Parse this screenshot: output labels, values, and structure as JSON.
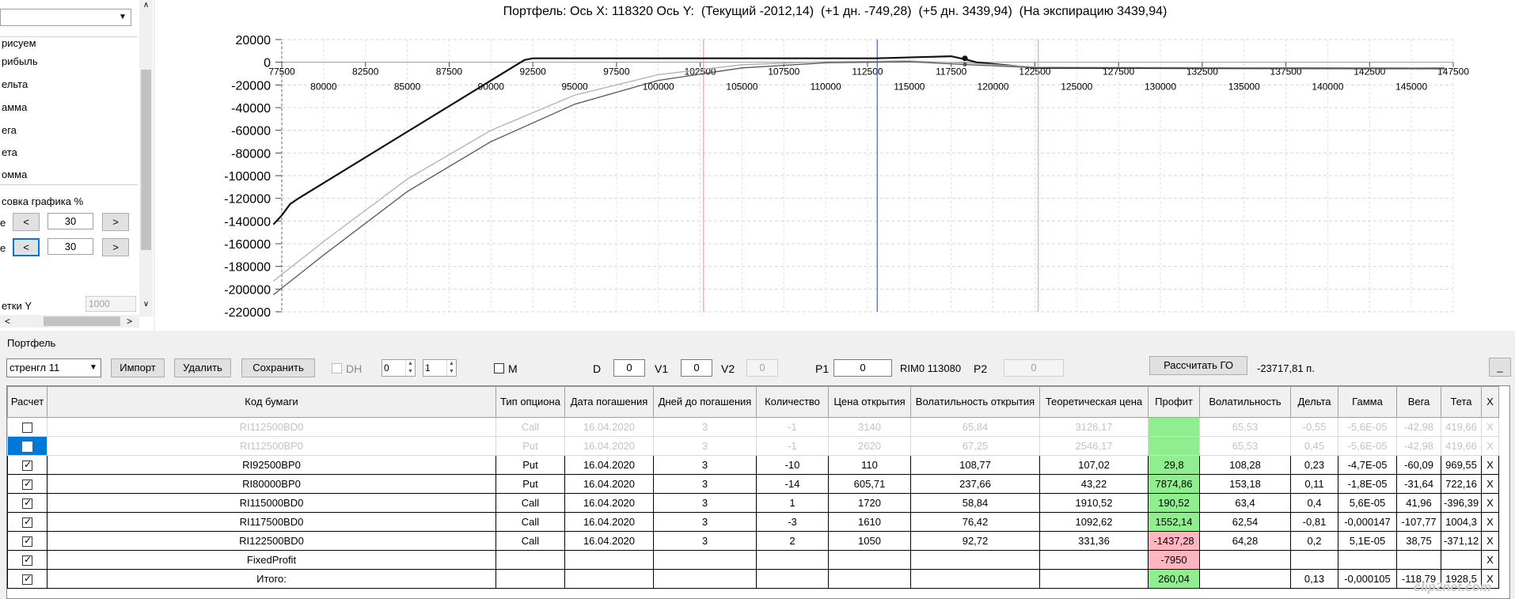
{
  "left_panel": {
    "series": [
      "рисуем",
      "рибыль",
      "ельта",
      "амма",
      "ега",
      "ета",
      "омма"
    ],
    "scale_title": "совка графика %",
    "row1_label": "е",
    "row2_label": "е",
    "row1_value": "30",
    "row2_value": "30",
    "prev_label": "<",
    "next_label": ">",
    "y_spacing_label": "етки Y",
    "y_spacing_value": "1000",
    "scroll_up": "∧",
    "scroll_down": "∨",
    "scroll_left": "<",
    "scroll_right": ">"
  },
  "chart": {
    "title": "Портфель: Ось X: 118320 Ось Y:  (Текущий -2012,14)  (+1 дн. -749,28)  (+5 дн. 3439,94)  (На экспирацию 3439,94)"
  },
  "chart_data": {
    "type": "line",
    "xlim": [
      77500,
      147500
    ],
    "ylim": [
      -220000,
      20000
    ],
    "x_ticks_upper": [
      77500,
      82500,
      87500,
      92500,
      97500,
      102500,
      107500,
      112500,
      117500,
      122500,
      127500,
      132500,
      137500,
      142500,
      147500
    ],
    "x_ticks_lower": [
      80000,
      85000,
      90000,
      95000,
      100000,
      105000,
      110000,
      115000,
      120000,
      125000,
      130000,
      135000,
      140000,
      145000
    ],
    "y_ticks": [
      20000,
      0,
      -20000,
      -40000,
      -60000,
      -80000,
      -100000,
      -120000,
      -140000,
      -160000,
      -180000,
      -200000,
      -220000
    ],
    "vertical_lines": [
      {
        "x": 102700,
        "color": "#f4a0a0"
      },
      {
        "x": 113080,
        "color": "#3c64c8"
      },
      {
        "x": 122700,
        "color": "#f4a0a0"
      }
    ],
    "cursor_point": {
      "x": 118320,
      "y": 3440
    },
    "series": [
      {
        "color": "#111111",
        "points": [
          [
            77000,
            -143000
          ],
          [
            77500,
            -135000
          ],
          [
            78000,
            -125000
          ],
          [
            78500,
            -120000
          ],
          [
            92000,
            2000
          ],
          [
            92500,
            3440
          ],
          [
            113000,
            3440
          ],
          [
            117500,
            5300
          ],
          [
            118500,
            2000
          ],
          [
            119000,
            0
          ],
          [
            122500,
            -5000
          ],
          [
            147000,
            -5500
          ]
        ]
      },
      {
        "color": "#b0b0b0",
        "points": [
          [
            77000,
            -193000
          ],
          [
            80000,
            -158000
          ],
          [
            85000,
            -103000
          ],
          [
            90000,
            -60000
          ],
          [
            95000,
            -29000
          ],
          [
            100000,
            -11000
          ],
          [
            105000,
            -2200
          ],
          [
            110000,
            500
          ],
          [
            115000,
            1200
          ],
          [
            118320,
            -749
          ],
          [
            122500,
            -4200
          ],
          [
            147000,
            -5500
          ]
        ]
      },
      {
        "color": "#555555",
        "points": [
          [
            77000,
            -205000
          ],
          [
            80000,
            -170000
          ],
          [
            85000,
            -114000
          ],
          [
            90000,
            -70000
          ],
          [
            95000,
            -37000
          ],
          [
            100000,
            -16000
          ],
          [
            105000,
            -5000
          ],
          [
            110000,
            -500
          ],
          [
            115000,
            500
          ],
          [
            118320,
            -2012
          ],
          [
            122500,
            -4800
          ],
          [
            147000,
            -5600
          ]
        ]
      }
    ]
  },
  "portfolio": {
    "label": "Портфель",
    "strategy": "стренгл 11",
    "import_btn": "Импорт",
    "delete_btn": "Удалить",
    "save_btn": "Сохранить",
    "dh_label": "DH",
    "spin1": "0",
    "spin2": "1",
    "m_label": "M",
    "d_label": "D",
    "d_value": "0",
    "v1_label": "V1",
    "v1_value": "0",
    "v2_label": "V2",
    "v2_value": "0",
    "p1_label": "P1",
    "p1_value": "0",
    "ticker_info": "RIM0 113080",
    "p2_label": "P2",
    "p2_value": "0",
    "calc_go_btn": "Рассчитать ГО",
    "go_value": "-23717,81 п.",
    "minimize": "_"
  },
  "table": {
    "headers": [
      "Расчет",
      "Код бумаги",
      "Тип опциона",
      "Дата погашения",
      "Дней до погашения",
      "Количество",
      "Цена открытия",
      "Волатильность открытия",
      "Теоретическая цена",
      "Профит",
      "Волатильность",
      "Дельта",
      "Гамма",
      "Вега",
      "Тета",
      "X"
    ],
    "rows": [
      {
        "code": "RI112500BD0",
        "type": "Call",
        "date": "16.04.2020",
        "days": "3",
        "qty": "-1",
        "price": "3140",
        "vol_open": "65,84",
        "theo": "3126,17",
        "profit": "",
        "vol": "65,53",
        "delta": "-0,55",
        "gamma": "-5,6E-05",
        "vega": "-42,98",
        "theta": "419,66",
        "x": "X"
      },
      {
        "code": "RI112500BP0",
        "type": "Put",
        "date": "16.04.2020",
        "days": "3",
        "qty": "-1",
        "price": "2620",
        "vol_open": "67,25",
        "theo": "2546,17",
        "profit": "",
        "vol": "65,53",
        "delta": "0,45",
        "gamma": "-5,6E-05",
        "vega": "-42,98",
        "theta": "419,66",
        "x": "X"
      },
      {
        "code": "RI92500BP0",
        "type": "Put",
        "date": "16.04.2020",
        "days": "3",
        "qty": "-10",
        "price": "110",
        "vol_open": "108,77",
        "theo": "107,02",
        "profit": "29,8",
        "vol": "108,28",
        "delta": "0,23",
        "gamma": "-4,7E-05",
        "vega": "-60,09",
        "theta": "969,55",
        "x": "X"
      },
      {
        "code": "RI80000BP0",
        "type": "Put",
        "date": "16.04.2020",
        "days": "3",
        "qty": "-14",
        "price": "605,71",
        "vol_open": "237,66",
        "theo": "43,22",
        "profit": "7874,86",
        "vol": "153,18",
        "delta": "0,11",
        "gamma": "-1,8E-05",
        "vega": "-31,64",
        "theta": "722,16",
        "x": "X"
      },
      {
        "code": "RI115000BD0",
        "type": "Call",
        "date": "16.04.2020",
        "days": "3",
        "qty": "1",
        "price": "1720",
        "vol_open": "58,84",
        "theo": "1910,52",
        "profit": "190,52",
        "vol": "63,4",
        "delta": "0,4",
        "gamma": "5,6E-05",
        "vega": "41,96",
        "theta": "-396,39",
        "x": "X"
      },
      {
        "code": "RI117500BD0",
        "type": "Call",
        "date": "16.04.2020",
        "days": "3",
        "qty": "-3",
        "price": "1610",
        "vol_open": "76,42",
        "theo": "1092,62",
        "profit": "1552,14",
        "vol": "62,54",
        "delta": "-0,81",
        "gamma": "-0,000147",
        "vega": "-107,77",
        "theta": "1004,3",
        "x": "X"
      },
      {
        "code": "RI122500BD0",
        "type": "Call",
        "date": "16.04.2020",
        "days": "3",
        "qty": "2",
        "price": "1050",
        "vol_open": "92,72",
        "theo": "331,36",
        "profit": "-1437,28",
        "vol": "64,28",
        "delta": "0,2",
        "gamma": "5,1E-05",
        "vega": "38,75",
        "theta": "-371,12",
        "x": "X"
      },
      {
        "code": "FixedProfit",
        "type": "",
        "date": "",
        "days": "",
        "qty": "",
        "price": "",
        "vol_open": "",
        "theo": "",
        "profit": "-7950",
        "vol": "",
        "delta": "",
        "gamma": "",
        "vega": "",
        "theta": "",
        "x": "X"
      },
      {
        "code": "Итого:",
        "type": "",
        "date": "",
        "days": "",
        "qty": "",
        "price": "",
        "vol_open": "",
        "theo": "",
        "profit": "260,04",
        "vol": "",
        "delta": "0,13",
        "gamma": "-0,000105",
        "vega": "-118,79",
        "theta": "1928,5",
        "x": "X"
      }
    ]
  },
  "watermark": "clip2net.com"
}
